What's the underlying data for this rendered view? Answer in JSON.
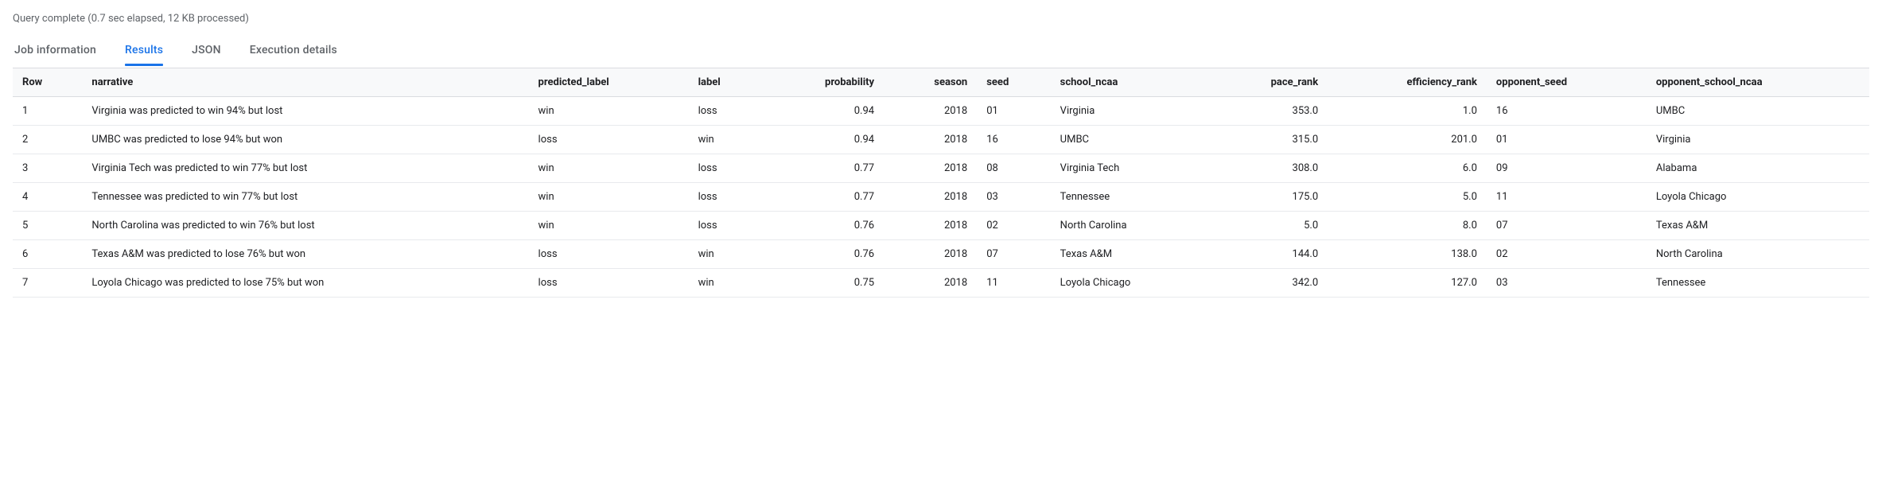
{
  "status": "Query complete (0.7 sec elapsed, 12 KB processed)",
  "tabs": {
    "job_info": "Job information",
    "results": "Results",
    "json": "JSON",
    "execution": "Execution details"
  },
  "columns": {
    "row": "Row",
    "narrative": "narrative",
    "predicted_label": "predicted_label",
    "label": "label",
    "probability": "probability",
    "season": "season",
    "seed": "seed",
    "school_ncaa": "school_ncaa",
    "pace_rank": "pace_rank",
    "efficiency_rank": "efficiency_rank",
    "opponent_seed": "opponent_seed",
    "opponent_school_ncaa": "opponent_school_ncaa"
  },
  "rows": [
    {
      "row": "1",
      "narrative": "Virginia was predicted to win 94% but lost",
      "predicted_label": "win",
      "label": "loss",
      "probability": "0.94",
      "season": "2018",
      "seed": "01",
      "school_ncaa": "Virginia",
      "pace_rank": "353.0",
      "efficiency_rank": "1.0",
      "opponent_seed": "16",
      "opponent_school_ncaa": "UMBC"
    },
    {
      "row": "2",
      "narrative": "UMBC was predicted to lose 94% but won",
      "predicted_label": "loss",
      "label": "win",
      "probability": "0.94",
      "season": "2018",
      "seed": "16",
      "school_ncaa": "UMBC",
      "pace_rank": "315.0",
      "efficiency_rank": "201.0",
      "opponent_seed": "01",
      "opponent_school_ncaa": "Virginia"
    },
    {
      "row": "3",
      "narrative": "Virginia Tech was predicted to win 77% but lost",
      "predicted_label": "win",
      "label": "loss",
      "probability": "0.77",
      "season": "2018",
      "seed": "08",
      "school_ncaa": "Virginia Tech",
      "pace_rank": "308.0",
      "efficiency_rank": "6.0",
      "opponent_seed": "09",
      "opponent_school_ncaa": "Alabama"
    },
    {
      "row": "4",
      "narrative": "Tennessee was predicted to win 77% but lost",
      "predicted_label": "win",
      "label": "loss",
      "probability": "0.77",
      "season": "2018",
      "seed": "03",
      "school_ncaa": "Tennessee",
      "pace_rank": "175.0",
      "efficiency_rank": "5.0",
      "opponent_seed": "11",
      "opponent_school_ncaa": "Loyola Chicago"
    },
    {
      "row": "5",
      "narrative": "North Carolina was predicted to win 76% but lost",
      "predicted_label": "win",
      "label": "loss",
      "probability": "0.76",
      "season": "2018",
      "seed": "02",
      "school_ncaa": "North Carolina",
      "pace_rank": "5.0",
      "efficiency_rank": "8.0",
      "opponent_seed": "07",
      "opponent_school_ncaa": "Texas A&M"
    },
    {
      "row": "6",
      "narrative": "Texas A&M was predicted to lose 76% but won",
      "predicted_label": "loss",
      "label": "win",
      "probability": "0.76",
      "season": "2018",
      "seed": "07",
      "school_ncaa": "Texas A&M",
      "pace_rank": "144.0",
      "efficiency_rank": "138.0",
      "opponent_seed": "02",
      "opponent_school_ncaa": "North Carolina"
    },
    {
      "row": "7",
      "narrative": "Loyola Chicago was predicted to lose 75% but won",
      "predicted_label": "loss",
      "label": "win",
      "probability": "0.75",
      "season": "2018",
      "seed": "11",
      "school_ncaa": "Loyola Chicago",
      "pace_rank": "342.0",
      "efficiency_rank": "127.0",
      "opponent_seed": "03",
      "opponent_school_ncaa": "Tennessee"
    }
  ]
}
